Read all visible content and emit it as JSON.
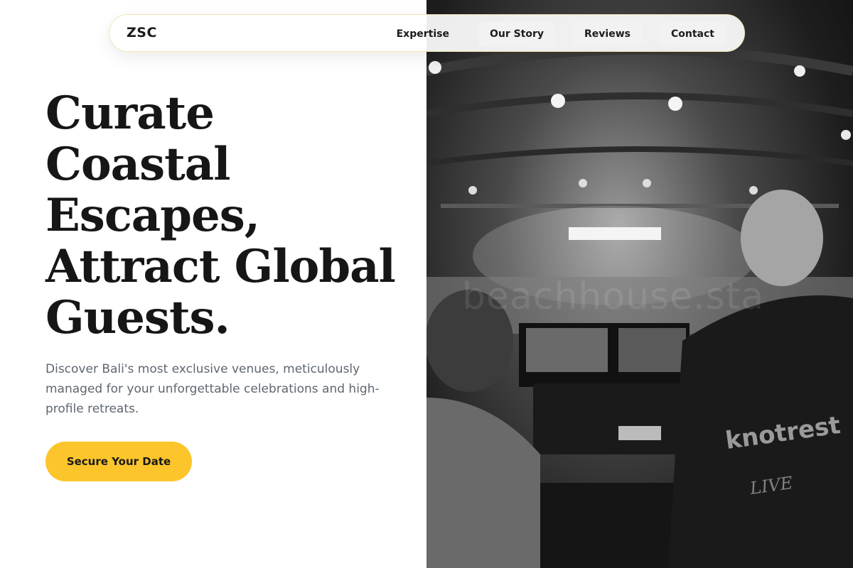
{
  "nav": {
    "logo": "ZSC",
    "links": [
      "Expertise",
      "Our Story",
      "Reviews",
      "Contact"
    ]
  },
  "hero": {
    "headline_lines": [
      "Curate",
      "Coastal",
      "Escapes,",
      "Attract Global",
      "Guests."
    ],
    "subtitle": "Discover Bali's most exclusive venues, meticulously managed for your unforgettable celebrations and high-profile retreats.",
    "cta": "Secure Your Date"
  },
  "photo": {
    "watermark": "beachhouse.sta",
    "shirt_text": "knotrest",
    "shirt_text_2": "LIVE"
  },
  "colors": {
    "accent": "#fcc52b",
    "text_dark": "#161616",
    "text_muted": "#5e6670"
  }
}
